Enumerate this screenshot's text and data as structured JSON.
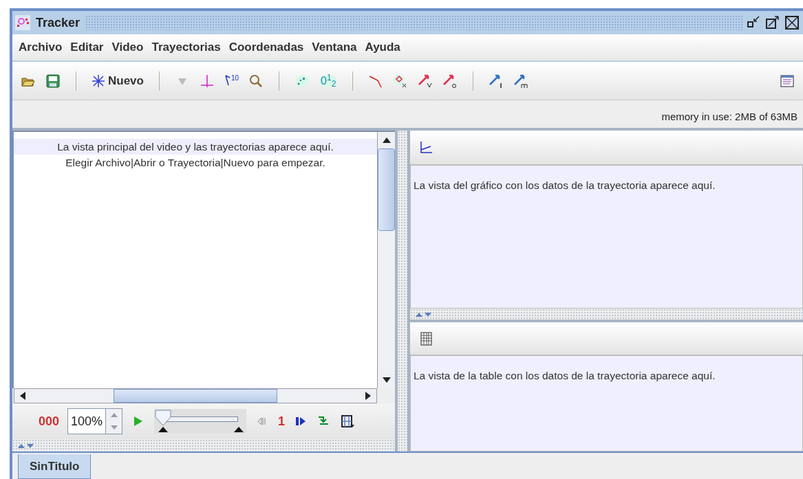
{
  "window": {
    "title": "Tracker"
  },
  "menu": [
    "Archivo",
    "Editar",
    "Video",
    "Trayectorias",
    "Coordenadas",
    "Ventana",
    "Ayuda"
  ],
  "toolbar": {
    "new_label": "Nuevo",
    "calibration_label": "10",
    "numbering_label": "0$^{1}$$_{2}$"
  },
  "memory": "memory in use: 2MB of 63MB",
  "video_view": {
    "lines": [
      "La vista principal del video y las trayectorias aparece aquí.",
      "Elegir Archivo|Abrir o Trayectoria|Nuevo para empezar."
    ]
  },
  "player": {
    "frame": "000",
    "zoom": "100%",
    "step": "1",
    "slider": {
      "level": 0
    }
  },
  "graph_view": {
    "message": "La vista del gráfico con los datos de la trayectoria aparece aquí."
  },
  "table_view": {
    "message": "La vista de la table con los datos de la trayectoria aparece aquí."
  },
  "tabs": [
    {
      "label": "SinTitulo",
      "selected": true
    }
  ]
}
